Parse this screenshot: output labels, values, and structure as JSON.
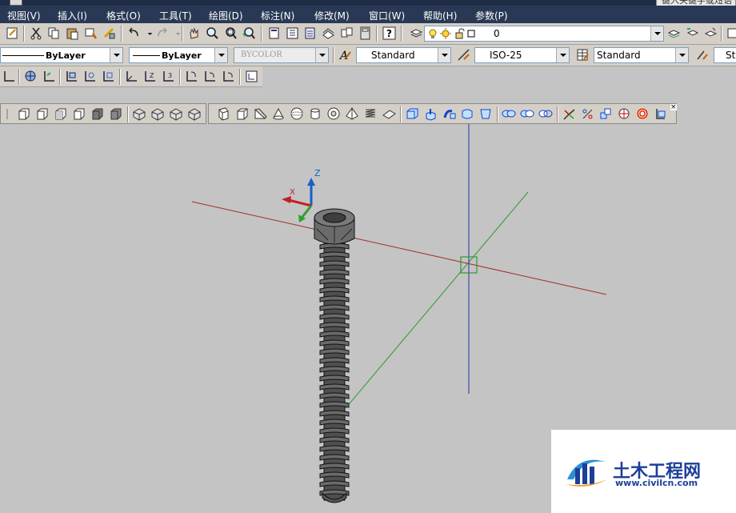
{
  "menu": {
    "items": [
      "视图(V)",
      "插入(I)",
      "格式(O)",
      "工具(T)",
      "绘图(D)",
      "标注(N)",
      "修改(M)",
      "窗口(W)",
      "帮助(H)",
      "参数(P)"
    ]
  },
  "title_bar": {
    "search_placeholder": "键入关键字或短语"
  },
  "layer": {
    "current": "0"
  },
  "properties": {
    "linetype": "ByLayer",
    "lineweight": "ByLayer",
    "plot_style": "BYCOLOR",
    "text_style": "Standard",
    "dim_style": "ISO-25",
    "table_style": "Standard",
    "multileader_style": "St"
  },
  "ucs_icon": {
    "x_label": "X",
    "z_label": "Z"
  },
  "colors": {
    "viewport_bg": "#c4c4c4",
    "menu_bg": "#293955",
    "axis_x": "#a52a2a",
    "axis_y": "#2e9a2e",
    "axis_z": "#2233aa",
    "screw": "#5a5a5a",
    "toolbar_bg": "#d4d0c8"
  },
  "watermark": {
    "name": "土木工程网",
    "url": "www.civilcn.com"
  },
  "toolbar_icons": {
    "standard": [
      "properties-icon",
      "cut-icon",
      "copy-icon",
      "paste-icon",
      "match-properties-icon",
      "block-editor-icon",
      "undo-icon",
      "redo-icon",
      "pan-icon",
      "zoom-realtime-icon",
      "zoom-window-icon",
      "zoom-previous-icon",
      "properties-palette-icon",
      "design-center-icon",
      "tool-palettes-icon",
      "sheet-set-icon",
      "markup-icon",
      "quickcalc-icon",
      "help-icon"
    ],
    "layers": [
      "layer-manager-icon",
      "layer-on-icon",
      "layer-freeze-icon",
      "layer-lock-icon",
      "layer-color-icon"
    ],
    "ucs": [
      "ucs-icon",
      "ucs-world-icon",
      "ucs-previous-icon",
      "ucs-face-icon",
      "ucs-object-icon",
      "ucs-view-icon",
      "ucs-origin-icon",
      "ucs-zaxis-icon",
      "ucs-3point-icon",
      "ucs-x-icon",
      "ucs-y-icon",
      "ucs-z-icon",
      "ucs-apply-icon"
    ],
    "views": [
      "top-view-icon",
      "bottom-view-icon",
      "left-view-icon",
      "right-view-icon",
      "front-view-icon",
      "back-view-icon",
      "sw-iso-icon",
      "se-iso-icon",
      "ne-iso-icon",
      "nw-iso-icon"
    ],
    "modeling": [
      "polysolid-icon",
      "box-icon",
      "wedge-icon",
      "cone-icon",
      "sphere-icon",
      "cylinder-icon",
      "torus-icon",
      "pyramid-icon",
      "helix-icon",
      "planar-surface-icon",
      "extrude-icon",
      "presspull-icon",
      "sweep-icon",
      "revolve-icon",
      "loft-icon",
      "union-icon",
      "subtract-icon",
      "intersect-icon",
      "3dmove-icon",
      "3drotate-icon",
      "3dalign-icon",
      "3darray-icon",
      "section-plane-icon",
      "camera-icon"
    ]
  }
}
